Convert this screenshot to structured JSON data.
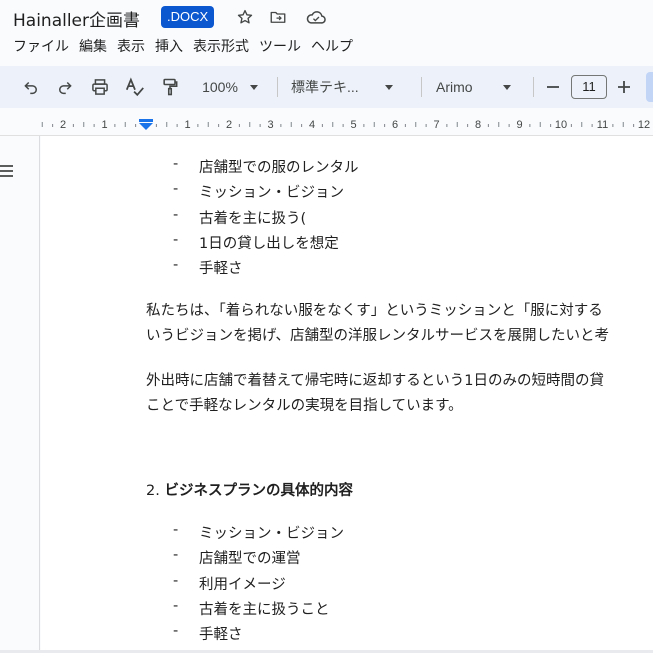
{
  "document": {
    "title": "Hainaller企画書",
    "extension": ".DOCX"
  },
  "title_icons": [
    "star-icon",
    "move-to-folder-icon",
    "cloud-status-icon"
  ],
  "menu": [
    "ファイル",
    "編集",
    "表示",
    "挿入",
    "表示形式",
    "ツール",
    "ヘルプ"
  ],
  "toolbar": {
    "zoom": "100%",
    "style": "標準テキ...",
    "font": "Arimo",
    "font_size": "11"
  },
  "ruler": {
    "labels": [
      "2",
      "1",
      "1",
      "2",
      "3",
      "4",
      "5",
      "6",
      "7",
      "8",
      "9",
      "10",
      "11",
      "12"
    ]
  },
  "content": {
    "bullets_1": [
      "店舗型での服のレンタル",
      "ミッション・ビジョン",
      "古着を主に扱う(",
      "1日の貸し出しを想定",
      "手軽さ"
    ],
    "paragraph_1": [
      "私たちは、「着られない服をなくす」というミッションと「服に対する",
      "いうビジョンを掲げ、店舗型の洋服レンタルサービスを展開したいと考"
    ],
    "paragraph_2": [
      "外出時に店舗で着替えて帰宅時に返却するという1日のみの短時間の貸",
      "ことで手軽なレンタルの実現を目指しています。"
    ],
    "heading_number": "2.",
    "heading_title": "ビジネスプランの具体的内容",
    "bullets_2": [
      "ミッション・ビジョン",
      "店舗型での運営",
      "利用イメージ",
      "古着を主に扱うこと",
      "手軽さ"
    ],
    "bullet_marker": "-"
  }
}
